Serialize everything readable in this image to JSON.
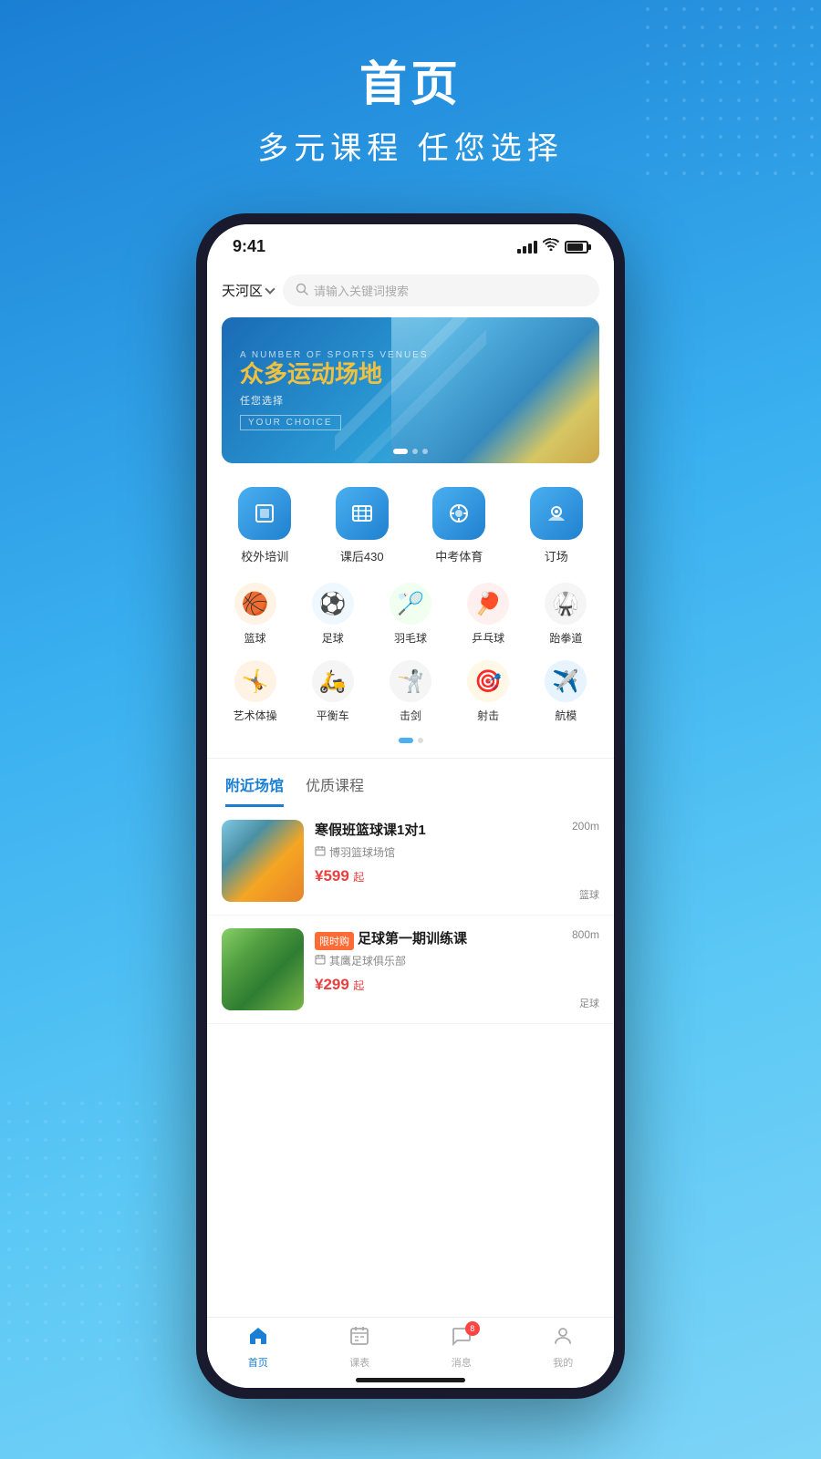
{
  "page": {
    "title": "首页",
    "subtitle": "多元课程 任您选择",
    "background_color": "#2a9ad4"
  },
  "status_bar": {
    "time": "9:41",
    "signal": "4",
    "wifi": true,
    "battery": 85
  },
  "search": {
    "location": "天河区",
    "placeholder": "请输入关键词搜索"
  },
  "banner": {
    "small_text": "A NUMBER OF SPORTS VENUES",
    "title_prefix": "众多",
    "title_highlight": "运动场地",
    "subtitle": "任您选择",
    "choice_text": "YOUR CHOICE",
    "dots": [
      {
        "active": true
      },
      {
        "active": false
      },
      {
        "active": false
      }
    ]
  },
  "main_categories": [
    {
      "label": "校外培训",
      "icon": "📋"
    },
    {
      "label": "课后430",
      "icon": "🏫"
    },
    {
      "label": "中考体育",
      "icon": "🎾"
    },
    {
      "label": "订场",
      "icon": "📍"
    }
  ],
  "sports_row1": [
    {
      "label": "篮球",
      "icon": "🏀",
      "bg": "#ff8c42"
    },
    {
      "label": "足球",
      "icon": "⚽",
      "bg": "#4ab0f0"
    },
    {
      "label": "羽毛球",
      "icon": "🏸",
      "bg": "#e8f4e8"
    },
    {
      "label": "乒乓球",
      "icon": "🏓",
      "bg": "#ff7f7f"
    },
    {
      "label": "跆拳道",
      "icon": "🥋",
      "bg": "#e8e8e8"
    }
  ],
  "sports_row2": [
    {
      "label": "艺术体操",
      "icon": "🤸",
      "bg": "#ffe0b2"
    },
    {
      "label": "平衡车",
      "icon": "🛵",
      "bg": "#e8e8e8"
    },
    {
      "label": "击剑",
      "icon": "🤺",
      "bg": "#e8e8e8"
    },
    {
      "label": "射击",
      "icon": "🎯",
      "bg": "#fff3e0"
    },
    {
      "label": "航模",
      "icon": "✈️",
      "bg": "#e3f2fd"
    }
  ],
  "tabs": [
    {
      "label": "附近场馆",
      "active": true
    },
    {
      "label": "优质课程",
      "active": false
    }
  ],
  "list_items": [
    {
      "title": "寒假班篮球课1对1",
      "venue": "博羽篮球场馆",
      "price": "¥599",
      "price_suffix": "起",
      "distance": "200m",
      "tag": "篮球",
      "limited": false
    },
    {
      "title": "足球第一期训练课",
      "venue": "其鹰足球俱乐部",
      "price": "¥299",
      "price_suffix": "起",
      "distance": "800m",
      "tag": "足球",
      "limited": true,
      "limited_text": "限时购"
    }
  ],
  "bottom_nav": [
    {
      "label": "首页",
      "active": true,
      "icon": "🏠"
    },
    {
      "label": "课表",
      "active": false,
      "icon": "📅"
    },
    {
      "label": "消息",
      "active": false,
      "icon": "💬",
      "badge": "8"
    },
    {
      "label": "我的",
      "active": false,
      "icon": "👤"
    }
  ]
}
